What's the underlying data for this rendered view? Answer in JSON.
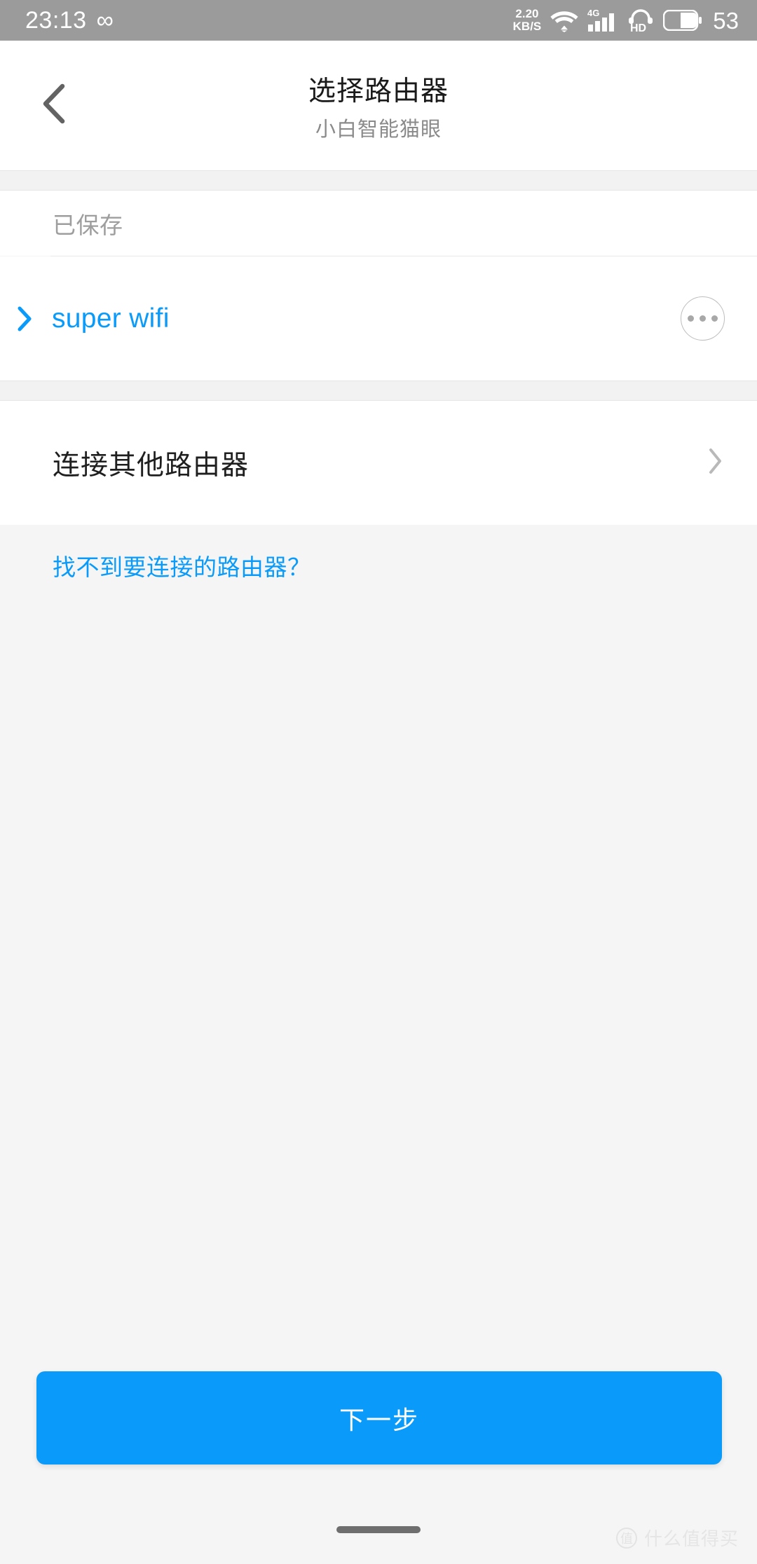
{
  "statusbar": {
    "time": "23:13",
    "infinity_glyph": "∞",
    "network_speed_value": "2.20",
    "network_speed_unit": "KB/S",
    "wifi_icon_name": "wifi-icon",
    "signal_label": "4G",
    "hd_top": "∩",
    "hd_label": "HD",
    "battery_percent": "53",
    "background_color": "#9b9b9b"
  },
  "header": {
    "back_icon": "chevron-left-icon",
    "title": "选择路由器",
    "subtitle": "小白智能猫眼"
  },
  "saved_section": {
    "label": "已保存",
    "networks": [
      {
        "name": "super wifi",
        "expand_icon": "chevron-right-icon",
        "more_icon": "ellipsis-icon",
        "color": "#0a9bfa"
      }
    ]
  },
  "other_router": {
    "label": "连接其他路由器",
    "chevron_icon": "chevron-right-icon"
  },
  "help": {
    "link_text": "找不到要连接的路由器？",
    "color": "#0a9bfa"
  },
  "footer": {
    "next_button_label": "下一步",
    "next_button_color": "#0a9bfa"
  },
  "watermark": {
    "badge_char": "值",
    "text": "什么值得买"
  }
}
